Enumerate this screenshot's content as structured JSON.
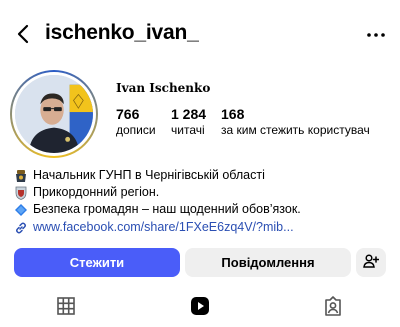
{
  "header": {
    "back_icon": "chevron-left-icon",
    "username": "ischenko_ivan_",
    "more_icon": "ellipsis-icon"
  },
  "profile": {
    "name": "Ivan Ischenko",
    "avatar_icon": "profile-photo",
    "stats": [
      {
        "value": "766",
        "label": "дописи"
      },
      {
        "value": "1 284",
        "label": "читачі"
      },
      {
        "value": "168",
        "label": "за ким стежить користувач"
      }
    ]
  },
  "bio": {
    "lines": [
      {
        "icon": "police-badge-icon",
        "text": "Начальник ГУНП в Чернігівській області"
      },
      {
        "icon": "shield-crest-icon",
        "text": "Прикордонний регіон."
      },
      {
        "icon": "blue-diamond-icon",
        "text": "Безпека громадян – наш щоденний обов’язок."
      }
    ],
    "link_icon": "link-icon",
    "link": "www.facebook.com/share/1FXeE6zq4V/?mib..."
  },
  "actions": {
    "follow_label": "Стежити",
    "message_label": "Повідомлення",
    "add_person_icon": "add-person-icon"
  },
  "tabs": [
    {
      "icon": "grid-icon",
      "selected": false
    },
    {
      "icon": "reels-icon",
      "selected": true
    },
    {
      "icon": "tagged-icon",
      "selected": false
    }
  ],
  "colors": {
    "accent": "#4a5df9",
    "link": "#2b4fb3",
    "secondary_button": "#efefef"
  }
}
